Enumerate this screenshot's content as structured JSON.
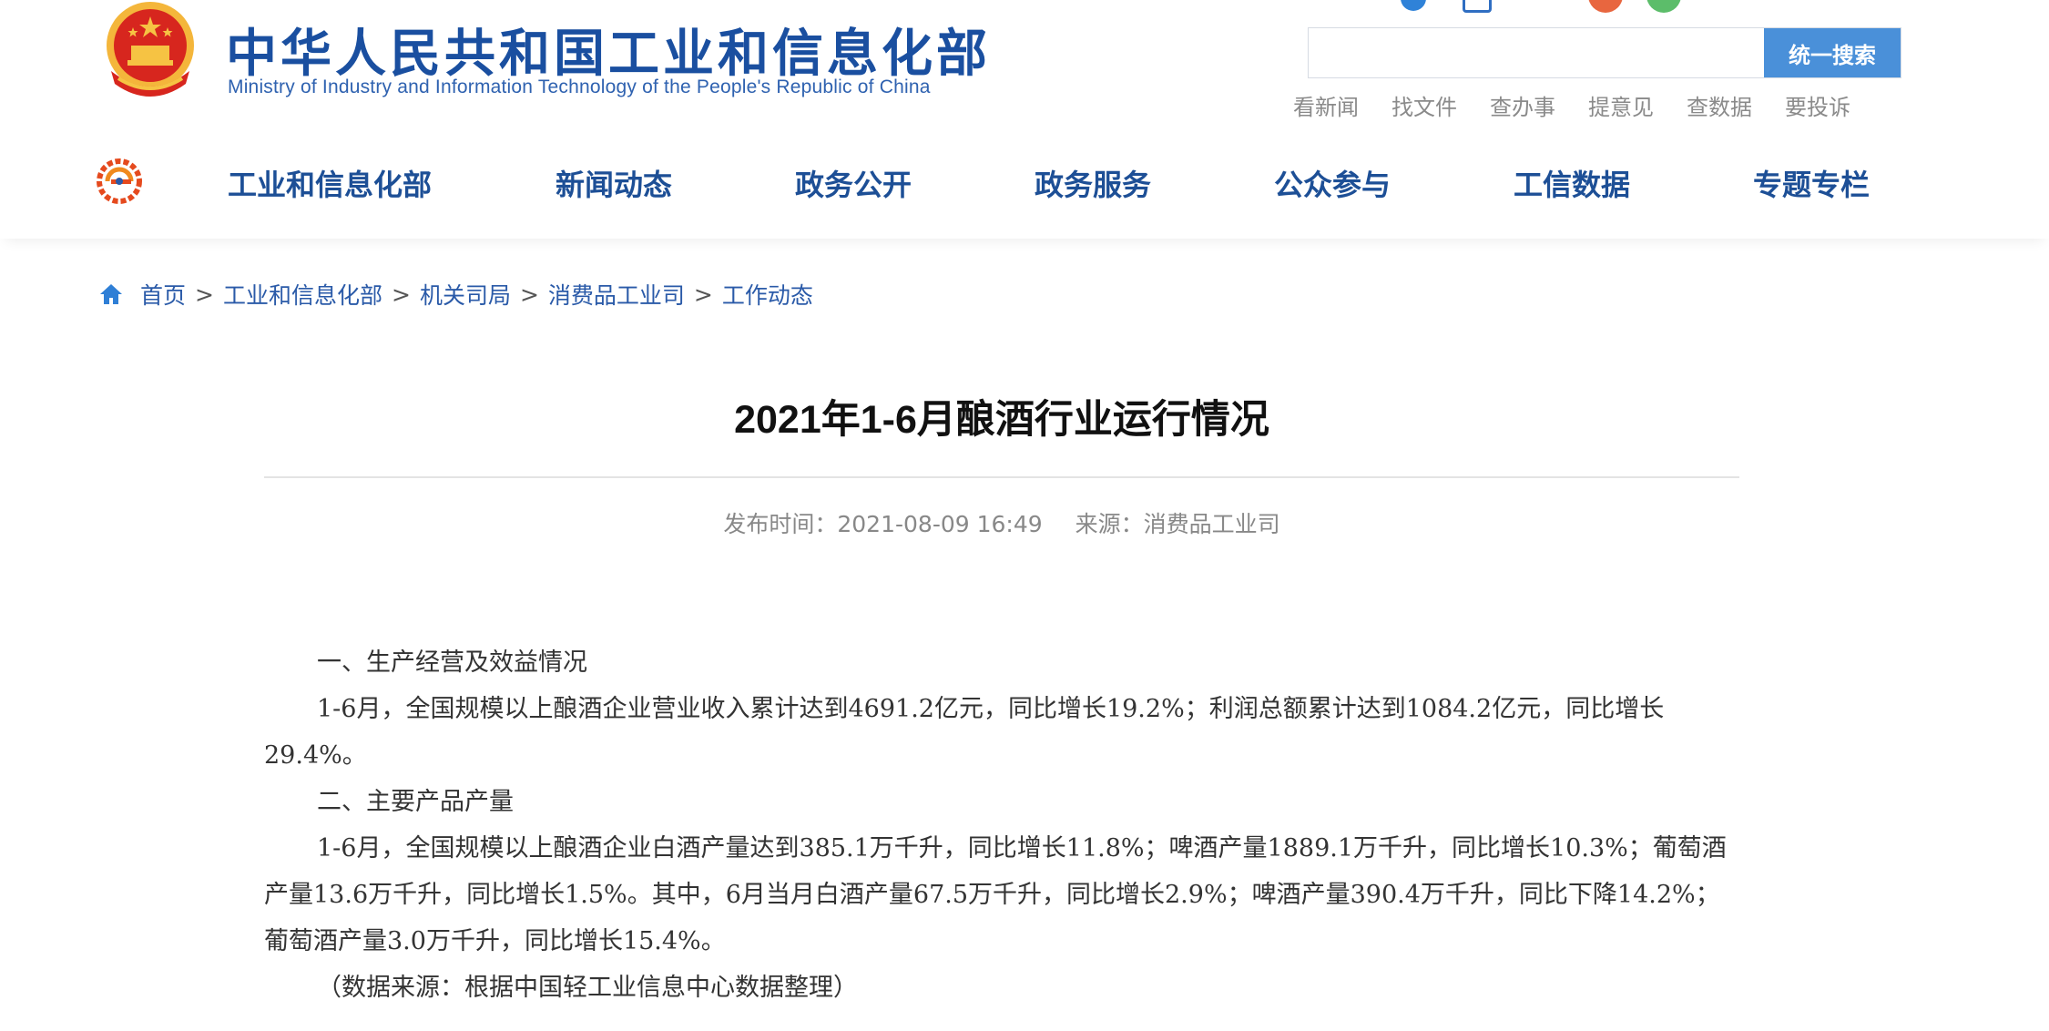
{
  "header": {
    "title": "中华人民共和国工业和信息化部",
    "subtitle": "Ministry of Industry and Information Technology of the People's Republic of China",
    "search": {
      "placeholder": "",
      "button_label": "统一搜索"
    },
    "quick_links": [
      "看新闻",
      "找文件",
      "查办事",
      "提意见",
      "查数据",
      "要投诉"
    ]
  },
  "nav": {
    "items": [
      "工业和信息化部",
      "新闻动态",
      "政务公开",
      "政务服务",
      "公众参与",
      "工信数据",
      "专题专栏"
    ]
  },
  "breadcrumb": {
    "items": [
      "首页",
      "工业和信息化部",
      "机关司局",
      "消费品工业司",
      "工作动态"
    ],
    "separator": ">"
  },
  "article": {
    "title": "2021年1-6月酿酒行业运行情况",
    "publish_time": "发布时间：2021-08-09 16:49",
    "source": "来源：消费品工业司",
    "paragraphs": [
      "一、生产经营及效益情况",
      "1-6月，全国规模以上酿酒企业营业收入累计达到4691.2亿元，同比增长19.2%；利润总额累计达到1084.2亿元，同比增长29.4%。",
      "二、主要产品产量",
      "1-6月，全国规模以上酿酒企业白酒产量达到385.1万千升，同比增长11.8%；啤酒产量1889.1万千升，同比增长10.3%；葡萄酒产量13.6万千升，同比增长1.5%。其中，6月当月白酒产量67.5万千升，同比增长2.9%；啤酒产量390.4万千升，同比下降14.2%；葡萄酒产量3.0万千升，同比增长15.4%。",
      "（数据来源：根据中国轻工业信息中心数据整理）"
    ]
  },
  "colors": {
    "brand_blue": "#1a4fa0",
    "nav_blue": "#1d4f96",
    "search_button": "#4a90d9",
    "emblem_red": "#d7261e",
    "emblem_gold": "#f6c343"
  }
}
